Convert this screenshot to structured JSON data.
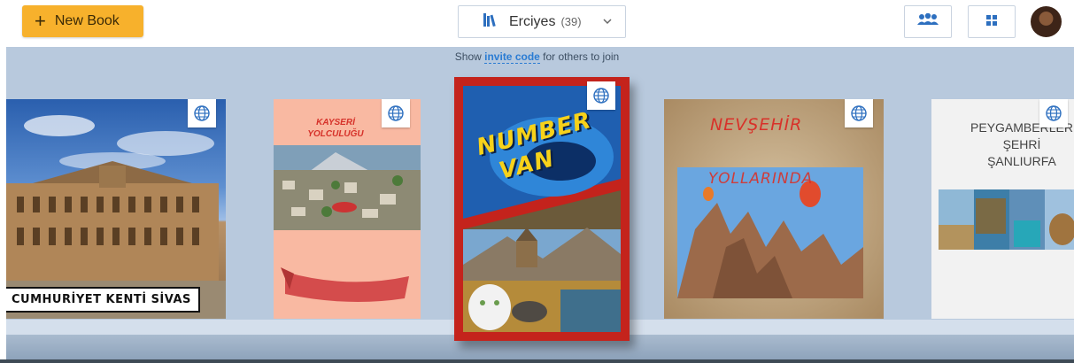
{
  "toolbar": {
    "new_book_label": "New Book",
    "new_book_icon": "plus-icon",
    "library_name": "Erciyes",
    "library_count": "(39)",
    "library_icon": "books-icon",
    "people_icon": "people-icon",
    "grid_icon": "grid-icon"
  },
  "invite": {
    "prefix": "Show",
    "code_label": "invite code",
    "suffix": "for others to join"
  },
  "books": [
    {
      "cover_title": "CUMHURİYET KENTİ SİVAS",
      "visibility_icon": "globe-icon"
    },
    {
      "cover_title_line1": "KAYSERİ",
      "cover_title_line2": "YOLCULUĞU",
      "visibility_icon": "globe-icon"
    },
    {
      "cover_title_line1": "NUMBER",
      "cover_title_line2": "VAN",
      "visibility_icon": "globe-icon"
    },
    {
      "cover_title_line1": "NEVŞEHİR",
      "cover_title_line2": "YOLLARINDA",
      "visibility_icon": "globe-icon"
    },
    {
      "cover_title_line1": "PEYGAMBERLER",
      "cover_title_line2": "ŞEHRİ",
      "cover_title_line3": "ŞANLIURFA",
      "visibility_icon": "globe-icon"
    }
  ],
  "colors": {
    "accent": "#f7b12c",
    "shelf": "#b8c9dd",
    "link": "#2b7cd3"
  }
}
